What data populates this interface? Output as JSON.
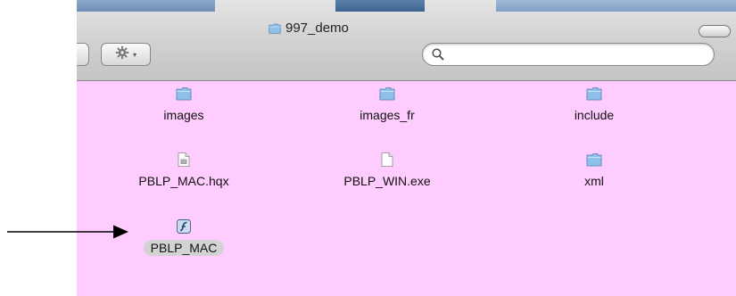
{
  "window": {
    "title": "997_demo",
    "search": {
      "value": "",
      "placeholder": ""
    }
  },
  "toolbar": {
    "action_icon": "gear-icon",
    "action_caret": "▾",
    "search_icon": "magnifier-icon"
  },
  "files": [
    {
      "name": "images",
      "icon": "folder-icon",
      "selected": false
    },
    {
      "name": "images_fr",
      "icon": "folder-icon",
      "selected": false
    },
    {
      "name": "include",
      "icon": "folder-icon",
      "selected": false
    },
    {
      "name": "PBLP_MAC.hqx",
      "icon": "document-icon",
      "selected": false
    },
    {
      "name": "PBLP_WIN.exe",
      "icon": "blank-document-icon",
      "selected": false
    },
    {
      "name": "xml",
      "icon": "folder-icon",
      "selected": false
    },
    {
      "name": "PBLP_MAC",
      "icon": "flash-app-icon",
      "selected": true
    }
  ],
  "colors": {
    "content_background": "#ffccff",
    "folder": "#8fc0ea",
    "selection": "#d3d3d3"
  }
}
